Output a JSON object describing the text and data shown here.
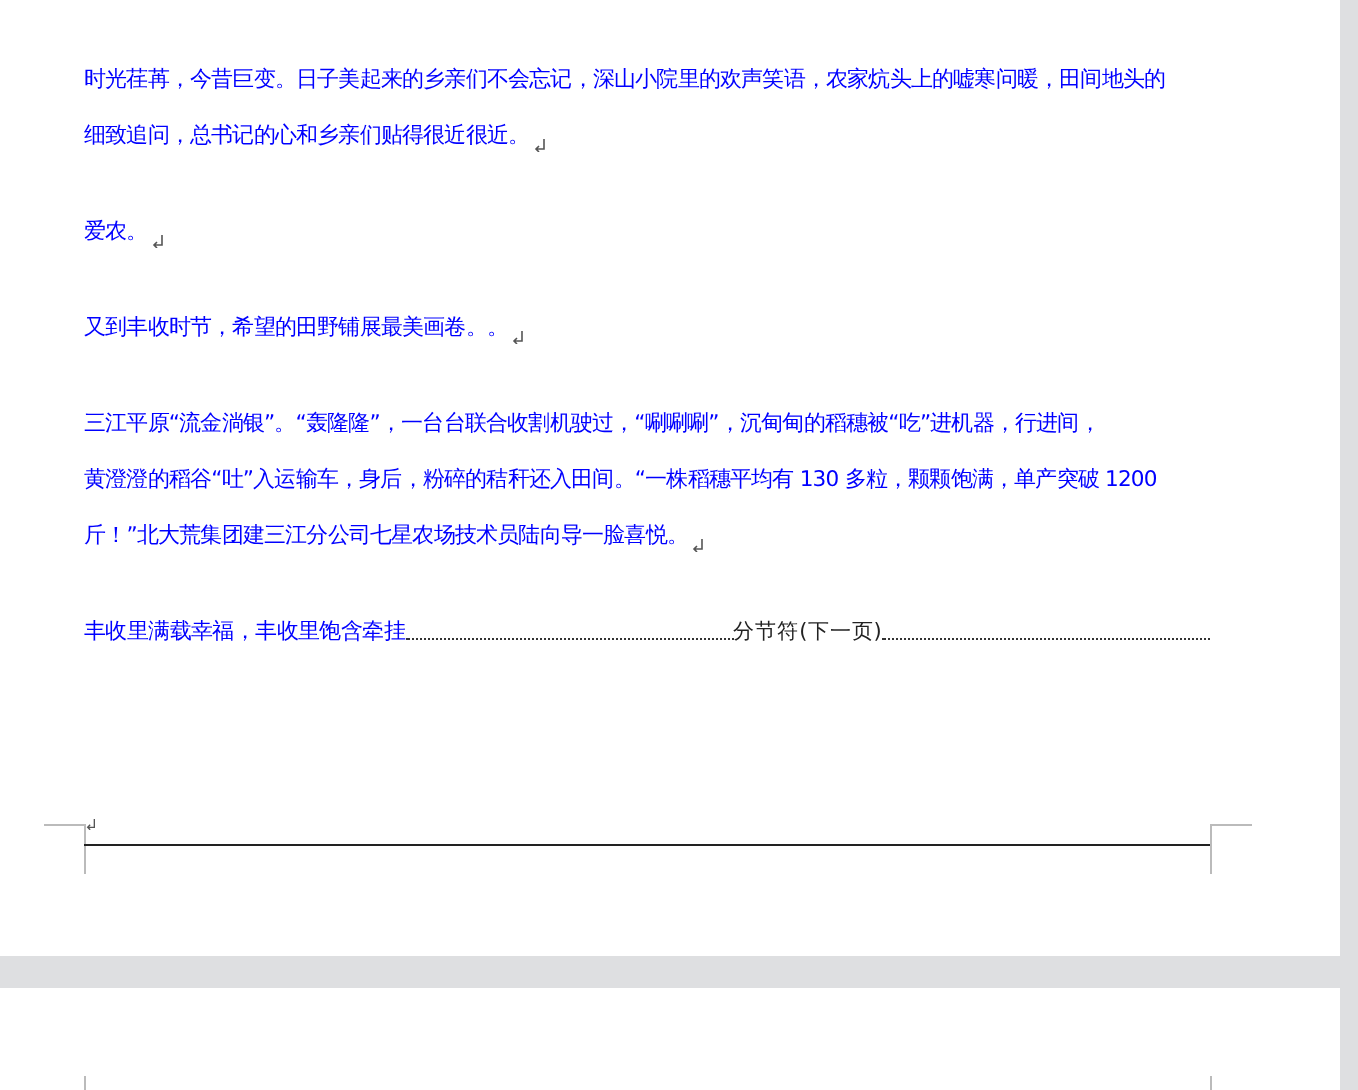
{
  "paragraphs": [
    {
      "lines": [
        "时光荏苒，今昔巨变。日子美起来的乡亲们不会忘记，深山小院里的欢声笑语，农家炕头上的嘘寒问暖，田间地头的",
        "细致追问，总书记的心和乡亲们贴得很近很近。"
      ],
      "mark": true
    },
    {
      "lines": [
        "爱农。"
      ],
      "mark": true
    },
    {
      "lines": [
        "又到丰收时节，希望的田野铺展最美画卷。。"
      ],
      "mark": true
    },
    {
      "lines": [
        "三江平原“流金淌银”。“轰隆隆”，一台台联合收割机驶过，“唰唰唰”，沉甸甸的稻穗被“吃”进机器，行进间，",
        "黄澄澄的稻谷“吐”入运输车，身后，粉碎的秸秆还入田间。“一株稻穗平均有 130 多粒，颗颗饱满，单产突破 1200",
        "斤！”北大荒集团建三江分公司七星农场技术员陆向导一脸喜悦。"
      ],
      "mark": true
    }
  ],
  "last_line": {
    "text": "丰收里满载幸福，丰收里饱含牵挂",
    "section_break": "分节符(下一页)"
  }
}
